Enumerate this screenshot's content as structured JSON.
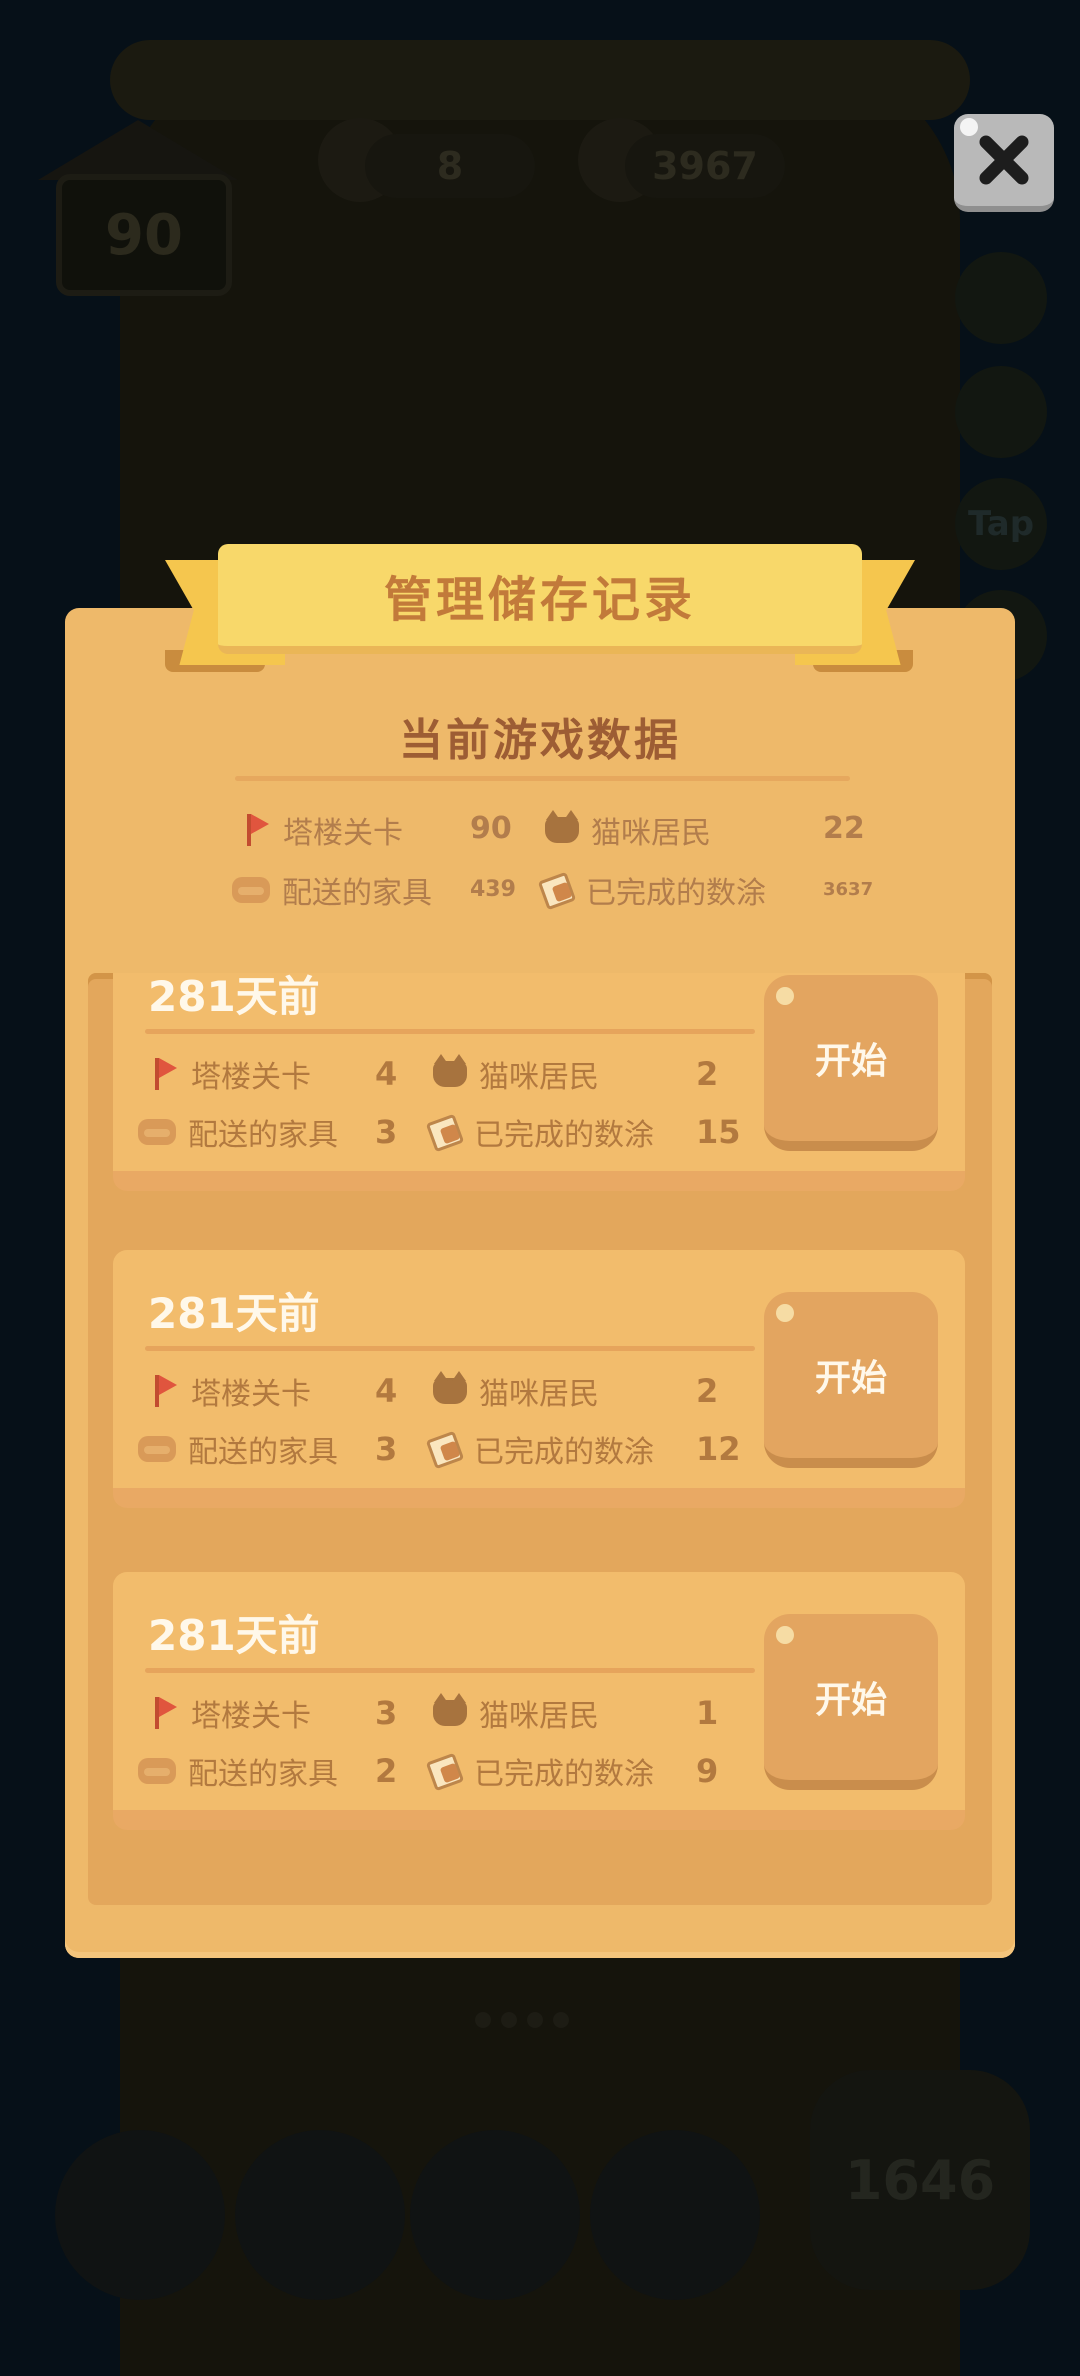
{
  "hud": {
    "tower_level": "90",
    "coins": "8",
    "tickets": "3967",
    "tap_label": "Tap",
    "score": "1646"
  },
  "dialog": {
    "title": "管理储存记录",
    "current_section_title": "当前游戏数据",
    "current": {
      "tower_level_label": "塔楼关卡",
      "tower_level_value": "90",
      "cat_residents_label": "猫咪居民",
      "cat_residents_value": "22",
      "furniture_label": "配送的家具",
      "furniture_value": "439",
      "paintings_label": "已完成的数涂",
      "paintings_value": "3637"
    },
    "records": [
      {
        "time": "281天前",
        "tower_level_label": "塔楼关卡",
        "tower_level": "4",
        "cat_residents_label": "猫咪居民",
        "cat_residents": "2",
        "furniture_label": "配送的家具",
        "furniture": "3",
        "paintings_label": "已完成的数涂",
        "paintings": "15",
        "start_label": "开始"
      },
      {
        "time": "281天前",
        "tower_level_label": "塔楼关卡",
        "tower_level": "4",
        "cat_residents_label": "猫咪居民",
        "cat_residents": "2",
        "furniture_label": "配送的家具",
        "furniture": "3",
        "paintings_label": "已完成的数涂",
        "paintings": "12",
        "start_label": "开始"
      },
      {
        "time": "281天前",
        "tower_level_label": "塔楼关卡",
        "tower_level": "3",
        "cat_residents_label": "猫咪居民",
        "cat_residents": "1",
        "furniture_label": "配送的家具",
        "furniture": "2",
        "paintings_label": "已完成的数涂",
        "paintings": "9",
        "start_label": "开始"
      }
    ]
  },
  "icons": {
    "close": "close-icon",
    "tower_level": "flag-icon",
    "cat_residents": "cat-icon",
    "furniture": "sofa-icon",
    "paintings": "paint-icon"
  },
  "colors": {
    "panel": "#eeb96a",
    "ribbon": "#f8d86a",
    "title_text": "#c27a3a",
    "record_card": "#f2bc6c",
    "start_button": "#e3a560",
    "overlay": "#061018"
  }
}
